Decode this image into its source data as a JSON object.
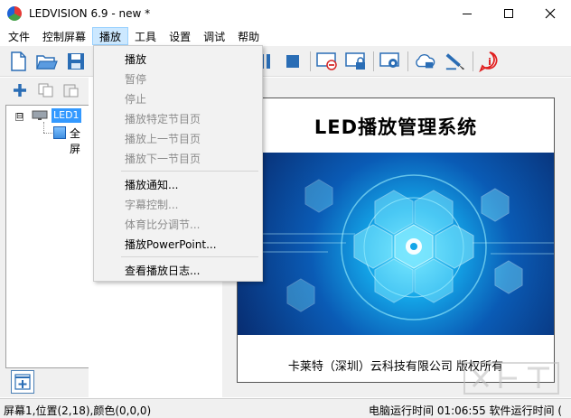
{
  "window": {
    "title": "LEDVISION 6.9 - new *",
    "minimize_icon": "minimize-icon",
    "maximize_icon": "maximize-icon",
    "close_icon": "close-icon"
  },
  "menubar": {
    "items": [
      "文件",
      "控制屏幕",
      "播放",
      "工具",
      "设置",
      "调试",
      "帮助"
    ],
    "active_index": 2
  },
  "toolbar": {
    "icons": [
      "new-file-icon",
      "open-folder-icon",
      "save-icon",
      "pause-icon",
      "stop-icon",
      "screen-off-icon",
      "lock-screen-icon",
      "settings-screen-icon",
      "cloud-icon",
      "brush-icon",
      "info-icon"
    ]
  },
  "left_toolbar": {
    "icons": [
      "add-icon",
      "copy-icon",
      "paste-icon"
    ]
  },
  "tree": {
    "root_label": "LED1",
    "child_label": "全屏",
    "expander": "⊟"
  },
  "play_menu": {
    "items": [
      {
        "label": "播放",
        "disabled": false
      },
      {
        "label": "暂停",
        "disabled": true
      },
      {
        "label": "停止",
        "disabled": true
      },
      {
        "label": "播放特定节目页",
        "disabled": true
      },
      {
        "label": "播放上一节目页",
        "disabled": true
      },
      {
        "label": "播放下一节目页",
        "disabled": true
      },
      {
        "label": "播放通知...",
        "disabled": false
      },
      {
        "label": "字幕控制...",
        "disabled": true
      },
      {
        "label": "体育比分调节...",
        "disabled": true
      },
      {
        "label": "播放PowerPoint...",
        "disabled": false
      },
      {
        "label": "查看播放日志...",
        "disabled": false
      }
    ]
  },
  "preview": {
    "title": "LED播放管理系统",
    "caption": "卡莱特（深圳）云科技有限公司  版权所有"
  },
  "statusbar": {
    "left": "屏幕1,位置(2,18),颜色(0,0,0)",
    "right": "电脑运行时间 01:06:55  软件运行时间 ("
  },
  "colors": {
    "accent": "#3399ff",
    "menu_active": "#cce8ff",
    "toolbar_bg": "#f0f0f0",
    "info_red": "#e02020"
  }
}
